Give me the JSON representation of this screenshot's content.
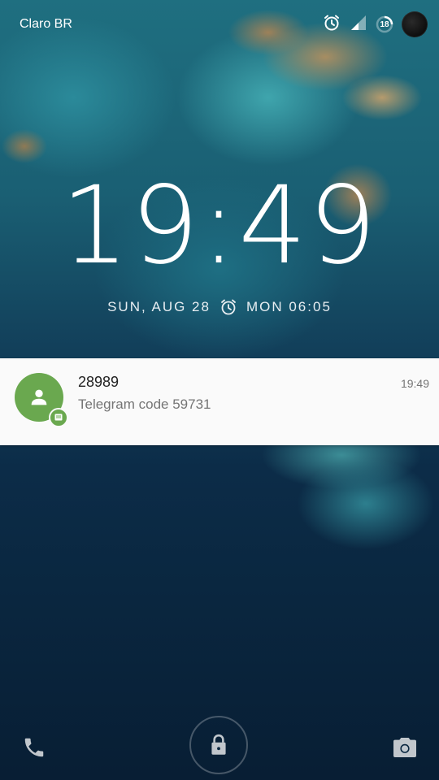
{
  "status_bar": {
    "carrier": "Claro BR",
    "battery_level": "18",
    "icons": [
      "alarm-icon",
      "signal-icon",
      "battery-icon",
      "avatar"
    ]
  },
  "lockscreen": {
    "time": "19:49",
    "date": "SUN, AUG 28",
    "next_alarm": "MON 06:05"
  },
  "notification": {
    "title": "28989",
    "text": "Telegram code 59731",
    "time": "19:49",
    "app_icon": "message-icon",
    "accent_color": "#6aa84f"
  },
  "bottom_bar": {
    "left_icon": "phone-icon",
    "center_icon": "lock-icon",
    "right_icon": "camera-icon"
  }
}
